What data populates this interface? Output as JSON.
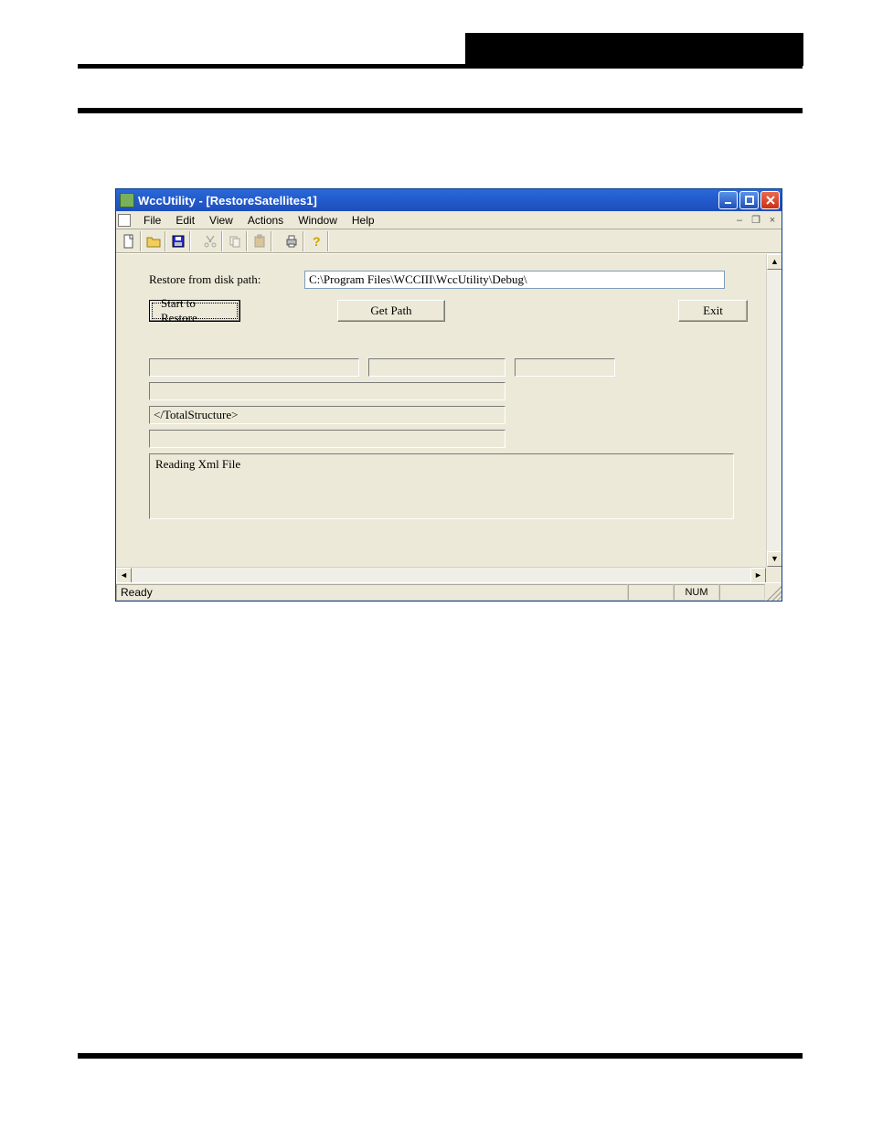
{
  "window": {
    "title": "WccUtility - [RestoreSatellites1]"
  },
  "menu": {
    "file": "File",
    "edit": "Edit",
    "view": "View",
    "actions": "Actions",
    "window": "Window",
    "help": "Help"
  },
  "toolbar_icons": {
    "new": "new-file-icon",
    "open": "open-folder-icon",
    "save": "save-floppy-icon",
    "cut": "cut-scissors-icon",
    "copy": "copy-icon",
    "paste": "paste-icon",
    "print": "print-icon",
    "help": "help-question-icon"
  },
  "form": {
    "restore_path_label": "Restore from disk path:",
    "restore_path_value": "C:\\Program Files\\WCCIII\\WccUtility\\Debug\\",
    "start_button": "Start to Restore",
    "get_path_button": "Get Path",
    "exit_button": "Exit",
    "progress_field1": "",
    "progress_field2": "",
    "progress_field3": "",
    "progress_wide1": "",
    "xml_tag_line": "</TotalStructure>",
    "progress_wide2": "",
    "log_text": "Reading Xml File"
  },
  "statusbar": {
    "ready": "Ready",
    "num": "NUM"
  }
}
